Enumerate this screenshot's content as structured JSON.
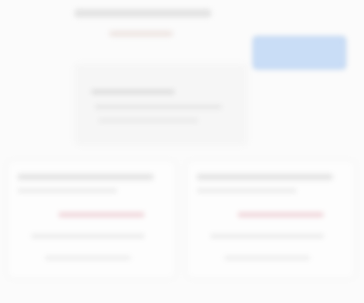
{
  "toolbar": {
    "primary_button_label": ""
  },
  "colors": {
    "background": "#fbfbfb",
    "button_fill": "#c9ddf6",
    "button_border": "#9ebfe8",
    "accent": "#f1d8dc"
  }
}
